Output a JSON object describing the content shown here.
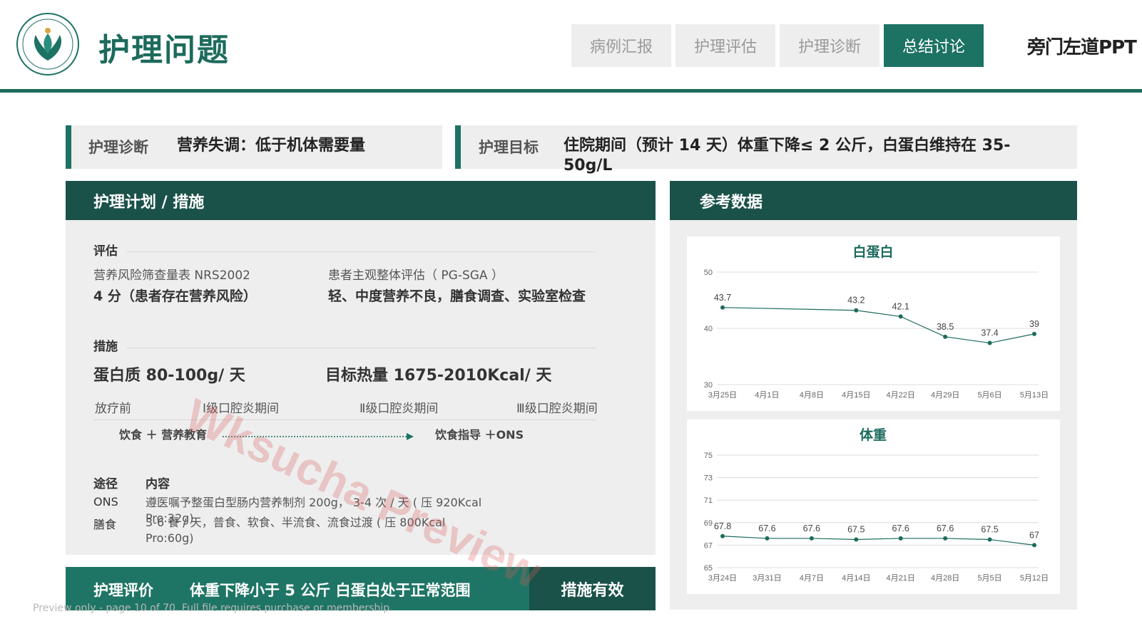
{
  "header": {
    "title": "护理问题",
    "brand": "旁门左道PPT",
    "tabs": [
      {
        "label": "病例汇报",
        "active": false
      },
      {
        "label": "护理评估",
        "active": false
      },
      {
        "label": "护理诊断",
        "active": false
      },
      {
        "label": "总结讨论",
        "active": true
      }
    ]
  },
  "diagnosis": {
    "label": "护理诊断",
    "text": "营养失调：低于机体需要量"
  },
  "goal": {
    "label": "护理目标",
    "text": "住院期间（预计 14 天）体重下降≤ 2 公斤，白蛋白维持在 35-50g/L"
  },
  "plan": {
    "heading": "护理计划 / 措施",
    "eval_title": "评估",
    "nrs_name": "营养风险筛查量表 NRS2002",
    "nrs_result": "4 分（患者存在营养风险）",
    "pgsga_name": "患者主观整体评估（ PG-SGA ）",
    "pgsga_result": "轻、中度营养不良，膳食调查、实验室检查",
    "measures_title": "措施",
    "protein": "蛋白质  80-100g/ 天",
    "calorie": "目标热量  1675-2010Kcal/ 天",
    "phases": [
      "放疗前",
      "Ⅰ级口腔炎期间",
      "Ⅱ级口腔炎期间",
      "Ⅲ级口腔炎期间"
    ],
    "flow_start": "饮食 ＋ 营养教育",
    "flow_end": "饮食指导 ＋ONS",
    "route_header": "途径",
    "content_header": "内容",
    "routes": [
      {
        "route": "ONS",
        "content": "遵医嘱予整蛋白型肠内营养制剂 200g， 3-4 次 / 天 ( 压 920Kcal Pro:32g)"
      },
      {
        "route": "膳食",
        "content": "3-6 餐 / 天，普食、软食、半流食、流食过渡 ( 压 800Kcal Pro:60g)"
      }
    ]
  },
  "evaluation": {
    "label": "护理评价",
    "text": "体重下降小于 5 公斤 白蛋白处于正常范围",
    "badge": "措施有效"
  },
  "reference": {
    "heading": "参考数据"
  },
  "watermark": "Wksucha Preview",
  "footer_note": "Preview only - page 10 of 70. Full file requires purchase or membership.",
  "chart_data": [
    {
      "type": "line",
      "title": "白蛋白",
      "categories": [
        "3月25日",
        "4月1日",
        "4月8日",
        "4月15日",
        "4月22日",
        "4月29日",
        "5月6日",
        "5月13日"
      ],
      "points": [
        {
          "x": "3月25日",
          "y": 43.7
        },
        {
          "x": "4月15日",
          "y": 43.2
        },
        {
          "x": "4月22日",
          "y": 42.1
        },
        {
          "x": "4月29日",
          "y": 38.5
        },
        {
          "x": "5月6日",
          "y": 37.4
        },
        {
          "x": "5月13日",
          "y": 39
        }
      ],
      "yticks": [
        30,
        40,
        50
      ],
      "ylim": [
        30,
        50
      ],
      "grid": true,
      "color": "#1c6b5c"
    },
    {
      "type": "line",
      "title": "体重",
      "categories": [
        "3月24日",
        "3月31日",
        "4月7日",
        "4月14日",
        "4月21日",
        "4月28日",
        "5月5日",
        "5月12日"
      ],
      "points": [
        {
          "x": "3月24日",
          "y": 67.8
        },
        {
          "x": "3月31日",
          "y": 67.6
        },
        {
          "x": "4月7日",
          "y": 67.6
        },
        {
          "x": "4月14日",
          "y": 67.5
        },
        {
          "x": "4月21日",
          "y": 67.6
        },
        {
          "x": "4月28日",
          "y": 67.6
        },
        {
          "x": "5月5日",
          "y": 67.5
        },
        {
          "x": "5月12日",
          "y": 67
        }
      ],
      "yticks": [
        65,
        67,
        69,
        71,
        73,
        75
      ],
      "ylim": [
        65,
        75
      ],
      "grid": true,
      "color": "#1c6b5c"
    }
  ]
}
